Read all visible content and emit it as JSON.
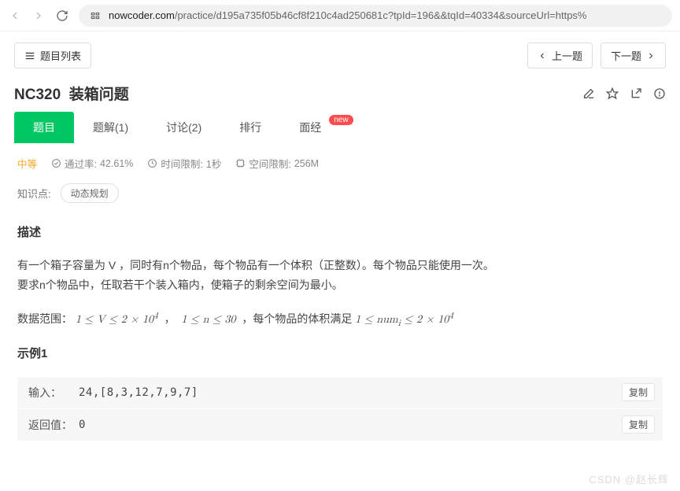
{
  "browser": {
    "domain": "nowcoder.com",
    "path": "/practice/d195a735f05b46cf8f210c4ad250681c?tpId=196&&tqId=40334&sourceUrl=https%"
  },
  "nav": {
    "list_button": "题目列表",
    "prev": "上一题",
    "next": "下一题"
  },
  "problem": {
    "code": "NC320",
    "title": "装箱问题"
  },
  "tabs": [
    {
      "label": "题目",
      "active": true
    },
    {
      "label": "题解(1)",
      "active": false
    },
    {
      "label": "讨论(2)",
      "active": false
    },
    {
      "label": "排行",
      "active": false
    },
    {
      "label": "面经",
      "active": false,
      "badge": "new"
    }
  ],
  "meta": {
    "level": "中等",
    "pass_label": "通过率:",
    "pass_value": "42.61%",
    "time_label": "时间限制:",
    "time_value": "1秒",
    "space_label": "空间限制:",
    "space_value": "256M"
  },
  "knowledge": {
    "label": "知识点:",
    "tags": [
      "动态规划"
    ]
  },
  "sections": {
    "desc_heading": "描述",
    "desc_p1": "有一个箱子容量为 V ，同时有n个物品，每个物品有一个体积（正整数）。每个物品只能使用一次。",
    "desc_p2": "要求n个物品中，任取若干个装入箱内，使箱子的剩余空间为最小。",
    "range_prefix": "数据范围：",
    "range_mid": "，每个物品的体积满足 ",
    "example_heading": "示例1",
    "input_label": "输入：",
    "input_value": "24,[8,3,12,7,9,7]",
    "return_label": "返回值：",
    "return_value": "0",
    "copy": "复制"
  },
  "math": {
    "v_low": "1 ≤ V ≤ 2 × 10",
    "v_exp": "4",
    "n_range": "1 ≤ n ≤ 30",
    "num_low": "1 ≤ num",
    "num_sub": "i",
    "num_high": " ≤ 2 × 10",
    "num_exp": "4"
  },
  "watermark": "CSDN @赵长辉"
}
